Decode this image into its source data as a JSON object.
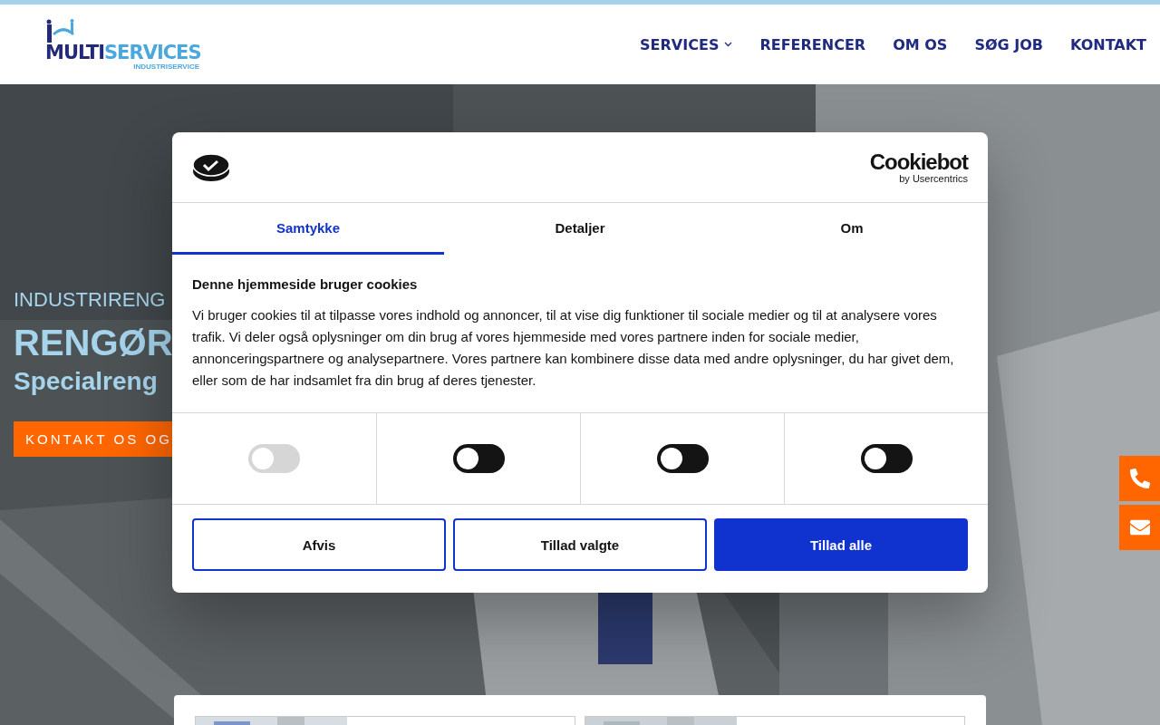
{
  "header": {
    "logo": {
      "name": "MULTI",
      "name_accent": "SERVICES",
      "tagline": "INDUSTRISERVICE"
    },
    "nav": [
      {
        "label": "SERVICES",
        "has_submenu": true
      },
      {
        "label": "REFERENCER",
        "has_submenu": false
      },
      {
        "label": "OM OS",
        "has_submenu": false
      },
      {
        "label": "SØG JOB",
        "has_submenu": false
      },
      {
        "label": "KONTAKT",
        "has_submenu": false
      }
    ]
  },
  "hero": {
    "kind": "picture",
    "eyebrow": "INDUSTRIRENG",
    "title": "RENGØR",
    "subtitle": "Specialreng",
    "cta": "KONTAKT OS OG"
  },
  "side_buttons": [
    {
      "kind": "phone"
    },
    {
      "kind": "mail"
    }
  ],
  "cookie_dialog": {
    "brand": "Cookiebot",
    "brand_sub": "by Usercentrics",
    "tabs": [
      {
        "label": "Samtykke",
        "selected": true
      },
      {
        "label": "Detaljer",
        "selected": false
      },
      {
        "label": "Om",
        "selected": false
      }
    ],
    "heading": "Denne hjemmeside bruger cookies",
    "text": "Vi bruger cookies til at tilpasse vores indhold og annoncer, til at vise dig funktioner til sociale medier og til at analysere vores trafik. Vi deler også oplysninger om din brug af vores hjemmeside med vores partnere inden for sociale medier, annonceringspartnere og analysepartnere. Vores partnere kan kombinere disse data med andre oplysninger, du har givet dem, eller som de har indsamlet fra din brug af deres tjenester.",
    "toggles": [
      {
        "on": false,
        "disabled": true
      },
      {
        "on": false,
        "disabled": false
      },
      {
        "on": false,
        "disabled": false
      },
      {
        "on": false,
        "disabled": false
      }
    ],
    "buttons": [
      {
        "label": "Afvis",
        "kind": "outline"
      },
      {
        "label": "Tillad valgte",
        "kind": "outline"
      },
      {
        "label": "Tillad alle",
        "kind": "primary"
      }
    ]
  }
}
